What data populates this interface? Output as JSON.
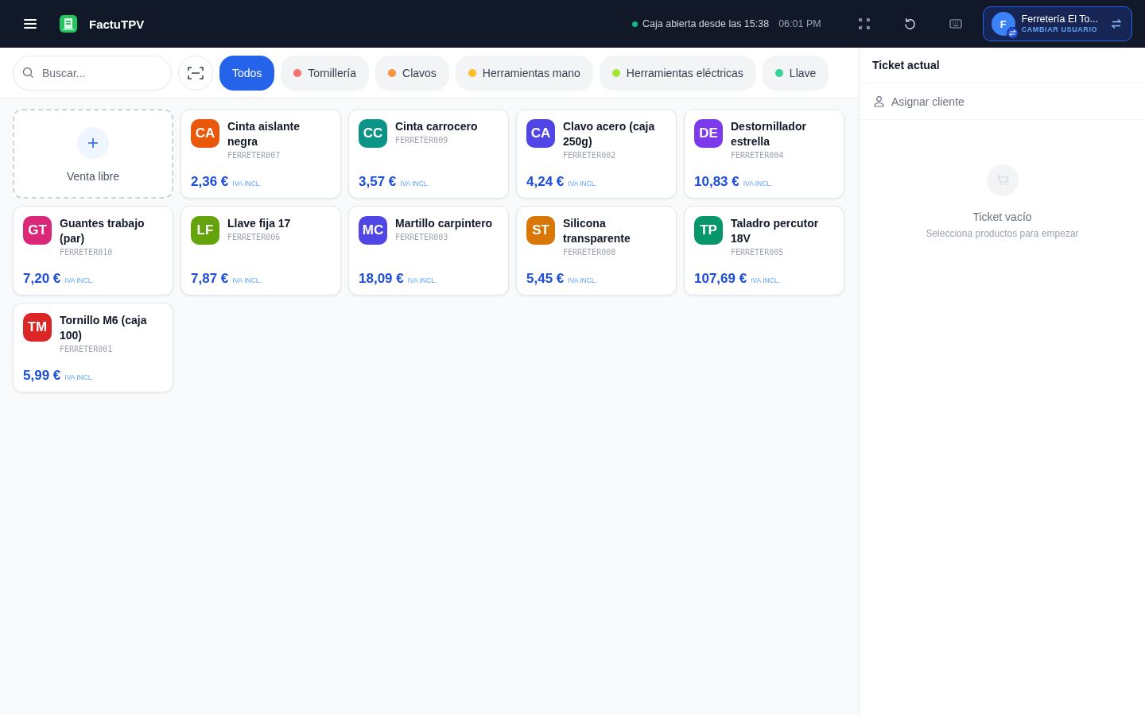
{
  "header": {
    "app_name": "FactuTPV",
    "status": {
      "text": "Caja abierta desde las 15:38",
      "color": "#10b981"
    },
    "time": "06:01 PM",
    "user": {
      "initial": "F",
      "name": "Ferretería El To...",
      "action": "CAMBIAR USUARIO"
    }
  },
  "toolbar": {
    "search": {
      "placeholder": "Buscar..."
    },
    "categories": [
      {
        "label": "Todos",
        "selected": true
      },
      {
        "label": "Tornillería",
        "color": "#f87171",
        "selected": false
      },
      {
        "label": "Clavos",
        "color": "#fb923c",
        "selected": false
      },
      {
        "label": "Herramientas mano",
        "color": "#fbbf24",
        "selected": false
      },
      {
        "label": "Herramientas eléctricas",
        "color": "#a3e635",
        "selected": false
      },
      {
        "label": "Llave",
        "color": "#34d399",
        "selected": false
      }
    ]
  },
  "products": [
    {
      "kind": "free",
      "name": "Venta libre"
    },
    {
      "kind": "product",
      "initials": "CA",
      "color": "#ea580c",
      "name": "Cinta aislante negra",
      "code": "FERRETER007",
      "price": "2,36 €",
      "tax": "IVA INCL."
    },
    {
      "kind": "product",
      "initials": "CC",
      "color": "#0d9488",
      "name": "Cinta carrocero",
      "code": "FERRETER009",
      "price": "3,57 €",
      "tax": "IVA INCL."
    },
    {
      "kind": "product",
      "initials": "CA",
      "color": "#4f46e5",
      "name": "Clavo acero (caja 250g)",
      "code": "FERRETER002",
      "price": "4,24 €",
      "tax": "IVA INCL."
    },
    {
      "kind": "product",
      "initials": "DE",
      "color": "#7c3aed",
      "name": "Destornillador estrella",
      "code": "FERRETER004",
      "price": "10,83 €",
      "tax": "IVA INCL."
    },
    {
      "kind": "product",
      "initials": "GT",
      "color": "#db2777",
      "name": "Guantes trabajo (par)",
      "code": "FERRETER010",
      "price": "7,20 €",
      "tax": "IVA INCL."
    },
    {
      "kind": "product",
      "initials": "LF",
      "color": "#65a30d",
      "name": "Llave fija 17",
      "code": "FERRETER006",
      "price": "7,87 €",
      "tax": "IVA INCL."
    },
    {
      "kind": "product",
      "initials": "MC",
      "color": "#4f46e5",
      "name": "Martillo carpintero",
      "code": "FERRETER003",
      "price": "18,09 €",
      "tax": "IVA INCL."
    },
    {
      "kind": "product",
      "initials": "ST",
      "color": "#d97706",
      "name": "Silicona transparente",
      "code": "FERRETER008",
      "price": "5,45 €",
      "tax": "IVA INCL."
    },
    {
      "kind": "product",
      "initials": "TP",
      "color": "#059669",
      "name": "Taladro percutor 18V",
      "code": "FERRETER005",
      "price": "107,69 €",
      "tax": "IVA INCL."
    },
    {
      "kind": "product",
      "initials": "TM",
      "color": "#dc2626",
      "name": "Tornillo M6 (caja 100)",
      "code": "FERRETER001",
      "price": "5,99 €",
      "tax": "IVA INCL."
    }
  ],
  "ticket": {
    "title": "Ticket actual",
    "assign_client": "Asignar cliente",
    "empty_title": "Ticket vacío",
    "empty_hint": "Selecciona productos para empezar"
  }
}
